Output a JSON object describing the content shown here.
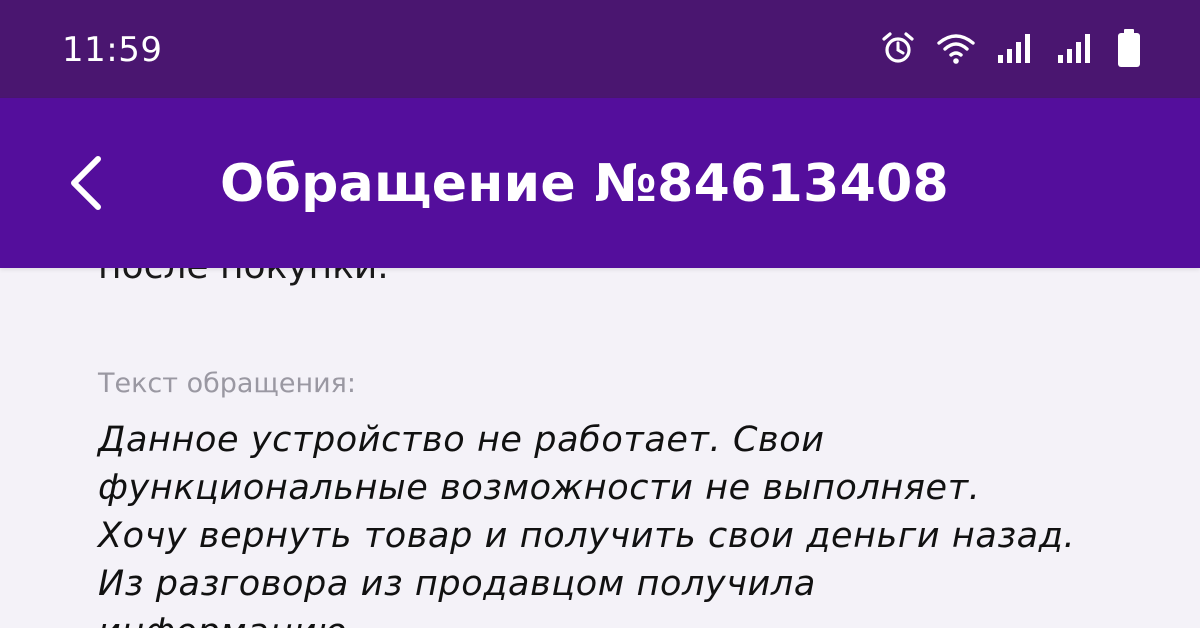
{
  "status_bar": {
    "time": "11:59",
    "icons": [
      "alarm-icon",
      "wifi-icon",
      "signal-icon",
      "signal-icon",
      "battery-icon"
    ]
  },
  "app_bar": {
    "back_icon": "chevron-left-icon",
    "title": "Обращение №84613408"
  },
  "content": {
    "clipped_previous_line": "после покупки.",
    "label": "Текст обращения:",
    "body_lines": [
      "Данное устройство не работает. Свои",
      "функциональные возможности не выполняет.",
      "Хочу вернуть товар и получить свои деньги назад.",
      "Из разговора из продавцом получила",
      "информацию"
    ]
  },
  "colors": {
    "status_bar": "#4a1670",
    "app_bar": "#540e9c",
    "background": "#f4f2f8",
    "label": "#9a98a2",
    "text": "#111111"
  }
}
